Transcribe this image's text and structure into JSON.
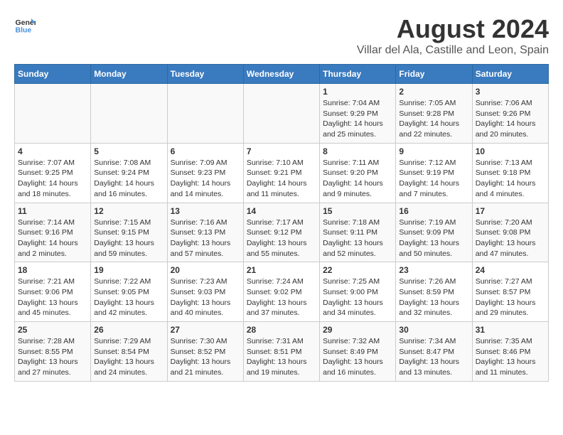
{
  "header": {
    "logo": {
      "line1": "General",
      "line2": "Blue"
    },
    "title": "August 2024",
    "subtitle": "Villar del Ala, Castille and Leon, Spain"
  },
  "calendar": {
    "weekdays": [
      "Sunday",
      "Monday",
      "Tuesday",
      "Wednesday",
      "Thursday",
      "Friday",
      "Saturday"
    ],
    "weeks": [
      [
        {
          "day": "",
          "info": ""
        },
        {
          "day": "",
          "info": ""
        },
        {
          "day": "",
          "info": ""
        },
        {
          "day": "",
          "info": ""
        },
        {
          "day": "1",
          "info": "Sunrise: 7:04 AM\nSunset: 9:29 PM\nDaylight: 14 hours\nand 25 minutes."
        },
        {
          "day": "2",
          "info": "Sunrise: 7:05 AM\nSunset: 9:28 PM\nDaylight: 14 hours\nand 22 minutes."
        },
        {
          "day": "3",
          "info": "Sunrise: 7:06 AM\nSunset: 9:26 PM\nDaylight: 14 hours\nand 20 minutes."
        }
      ],
      [
        {
          "day": "4",
          "info": "Sunrise: 7:07 AM\nSunset: 9:25 PM\nDaylight: 14 hours\nand 18 minutes."
        },
        {
          "day": "5",
          "info": "Sunrise: 7:08 AM\nSunset: 9:24 PM\nDaylight: 14 hours\nand 16 minutes."
        },
        {
          "day": "6",
          "info": "Sunrise: 7:09 AM\nSunset: 9:23 PM\nDaylight: 14 hours\nand 14 minutes."
        },
        {
          "day": "7",
          "info": "Sunrise: 7:10 AM\nSunset: 9:21 PM\nDaylight: 14 hours\nand 11 minutes."
        },
        {
          "day": "8",
          "info": "Sunrise: 7:11 AM\nSunset: 9:20 PM\nDaylight: 14 hours\nand 9 minutes."
        },
        {
          "day": "9",
          "info": "Sunrise: 7:12 AM\nSunset: 9:19 PM\nDaylight: 14 hours\nand 7 minutes."
        },
        {
          "day": "10",
          "info": "Sunrise: 7:13 AM\nSunset: 9:18 PM\nDaylight: 14 hours\nand 4 minutes."
        }
      ],
      [
        {
          "day": "11",
          "info": "Sunrise: 7:14 AM\nSunset: 9:16 PM\nDaylight: 14 hours\nand 2 minutes."
        },
        {
          "day": "12",
          "info": "Sunrise: 7:15 AM\nSunset: 9:15 PM\nDaylight: 13 hours\nand 59 minutes."
        },
        {
          "day": "13",
          "info": "Sunrise: 7:16 AM\nSunset: 9:13 PM\nDaylight: 13 hours\nand 57 minutes."
        },
        {
          "day": "14",
          "info": "Sunrise: 7:17 AM\nSunset: 9:12 PM\nDaylight: 13 hours\nand 55 minutes."
        },
        {
          "day": "15",
          "info": "Sunrise: 7:18 AM\nSunset: 9:11 PM\nDaylight: 13 hours\nand 52 minutes."
        },
        {
          "day": "16",
          "info": "Sunrise: 7:19 AM\nSunset: 9:09 PM\nDaylight: 13 hours\nand 50 minutes."
        },
        {
          "day": "17",
          "info": "Sunrise: 7:20 AM\nSunset: 9:08 PM\nDaylight: 13 hours\nand 47 minutes."
        }
      ],
      [
        {
          "day": "18",
          "info": "Sunrise: 7:21 AM\nSunset: 9:06 PM\nDaylight: 13 hours\nand 45 minutes."
        },
        {
          "day": "19",
          "info": "Sunrise: 7:22 AM\nSunset: 9:05 PM\nDaylight: 13 hours\nand 42 minutes."
        },
        {
          "day": "20",
          "info": "Sunrise: 7:23 AM\nSunset: 9:03 PM\nDaylight: 13 hours\nand 40 minutes."
        },
        {
          "day": "21",
          "info": "Sunrise: 7:24 AM\nSunset: 9:02 PM\nDaylight: 13 hours\nand 37 minutes."
        },
        {
          "day": "22",
          "info": "Sunrise: 7:25 AM\nSunset: 9:00 PM\nDaylight: 13 hours\nand 34 minutes."
        },
        {
          "day": "23",
          "info": "Sunrise: 7:26 AM\nSunset: 8:59 PM\nDaylight: 13 hours\nand 32 minutes."
        },
        {
          "day": "24",
          "info": "Sunrise: 7:27 AM\nSunset: 8:57 PM\nDaylight: 13 hours\nand 29 minutes."
        }
      ],
      [
        {
          "day": "25",
          "info": "Sunrise: 7:28 AM\nSunset: 8:55 PM\nDaylight: 13 hours\nand 27 minutes."
        },
        {
          "day": "26",
          "info": "Sunrise: 7:29 AM\nSunset: 8:54 PM\nDaylight: 13 hours\nand 24 minutes."
        },
        {
          "day": "27",
          "info": "Sunrise: 7:30 AM\nSunset: 8:52 PM\nDaylight: 13 hours\nand 21 minutes."
        },
        {
          "day": "28",
          "info": "Sunrise: 7:31 AM\nSunset: 8:51 PM\nDaylight: 13 hours\nand 19 minutes."
        },
        {
          "day": "29",
          "info": "Sunrise: 7:32 AM\nSunset: 8:49 PM\nDaylight: 13 hours\nand 16 minutes."
        },
        {
          "day": "30",
          "info": "Sunrise: 7:34 AM\nSunset: 8:47 PM\nDaylight: 13 hours\nand 13 minutes."
        },
        {
          "day": "31",
          "info": "Sunrise: 7:35 AM\nSunset: 8:46 PM\nDaylight: 13 hours\nand 11 minutes."
        }
      ]
    ]
  }
}
